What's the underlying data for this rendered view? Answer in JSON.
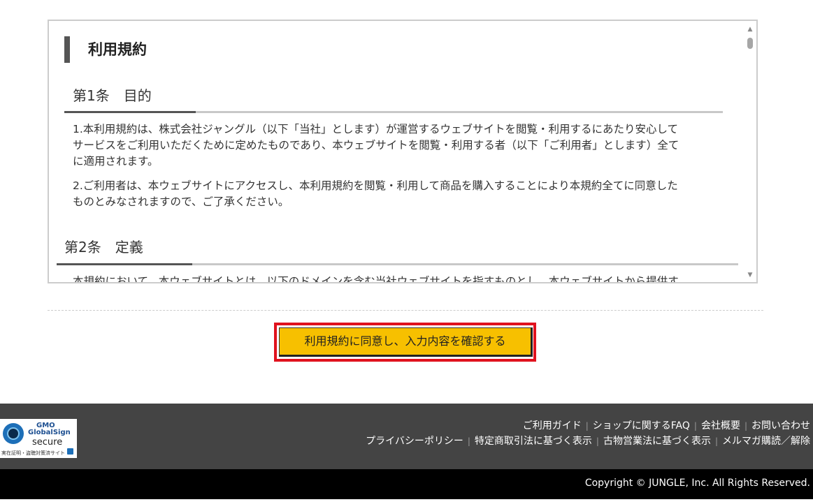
{
  "terms": {
    "heading": "利用規約",
    "article1": {
      "title": "第1条　目的",
      "para1": "1.本利用規約は、株式会社ジャングル（以下「当社」とします）が運営するウェブサイトを閲覧・利用するにあたり安心して",
      "para1b": "サービスをご利用いただくために定めたものであり、本ウェブサイトを閲覧・利用する者（以下「ご利用者」とします）全て",
      "para1c": "に適用されます。",
      "para2": "2.ご利用者は、本ウェブサイトにアクセスし、本利用規約を閲覧・利用して商品を購入することにより本規約全てに同意した",
      "para2b": "ものとみなされますので、ご了承ください。"
    },
    "article2": {
      "title": "第2条　定義",
      "para1": "本規約において、本ウェブサイトとは、以下のドメインを含む当社ウェブサイトを指すものとし、本ウェブサイトから提供す"
    }
  },
  "confirm_button": "利用規約に同意し、入力内容を確認する",
  "badge": {
    "line1": "GMO",
    "line2": "GlobalSign",
    "line3": "secure",
    "line4": "実在証明・盗聴対策済サイト"
  },
  "footer": {
    "row1": [
      "ご利用ガイド",
      "ショップに関するFAQ",
      "会社概要",
      "お問い合わせ"
    ],
    "row2": [
      "プライバシーポリシー",
      "特定商取引法に基づく表示",
      "古物営業法に基づく表示",
      "メルマガ購読／解除"
    ],
    "separator": "|",
    "copyright": "Copyright © JUNGLE, Inc. All Rights Reserved."
  }
}
